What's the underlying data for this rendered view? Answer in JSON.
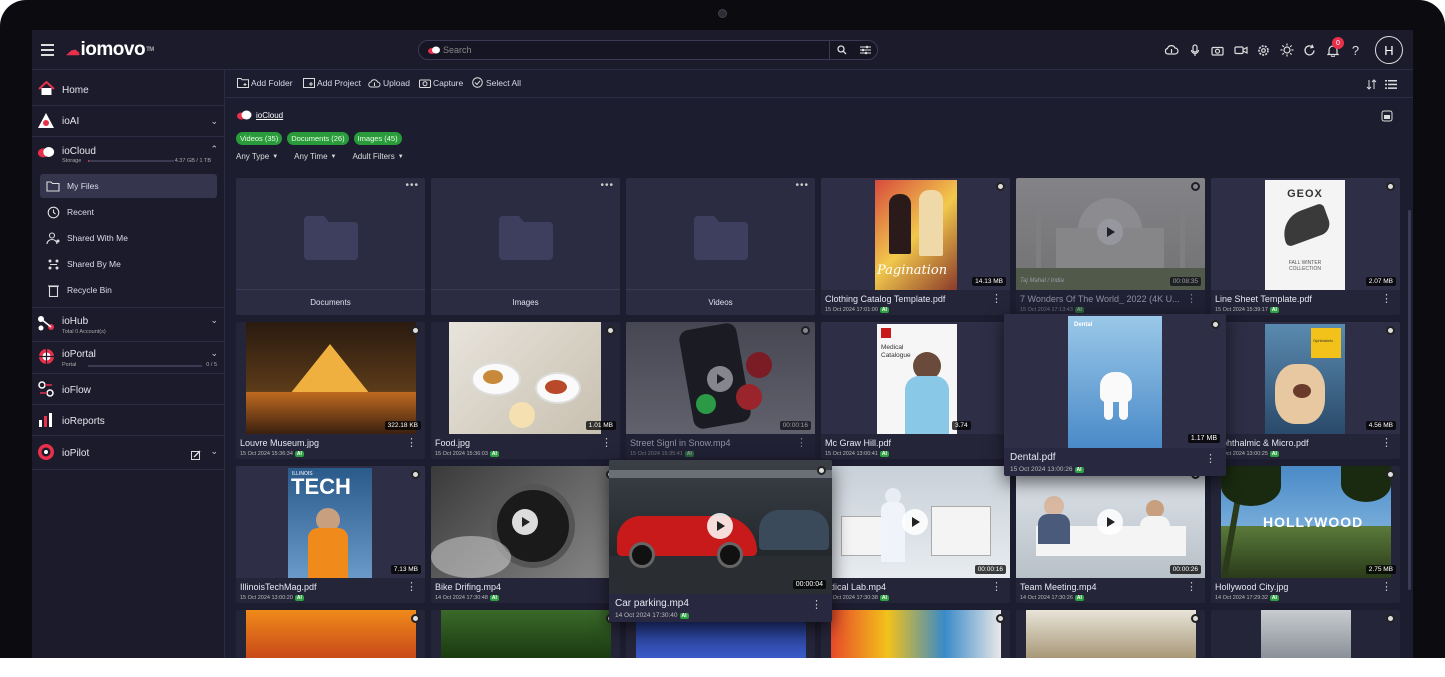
{
  "app": {
    "logo": "iomovo",
    "tm": "TM"
  },
  "search": {
    "placeholder": "Search"
  },
  "user": {
    "initial": "H",
    "notifications": "0"
  },
  "sidebar": {
    "home": "Home",
    "ioai": "ioAI",
    "iocloud": {
      "label": "ioCloud",
      "storage_label": "Storage",
      "storage_value": "4.37 GB / 1 TB",
      "storage_fraction": 0.004
    },
    "subitems": [
      "My Files",
      "Recent",
      "Shared With Me",
      "Shared By Me",
      "Recycle Bin"
    ],
    "iohub": {
      "label": "ioHub",
      "sub": "Total 0 Account(s)"
    },
    "ioportal": {
      "label": "ioPortal",
      "sub": "Portal",
      "value": "0 / 5"
    },
    "ioflow": "ioFlow",
    "ioreports": "ioReports",
    "iopilot": "ioPilot"
  },
  "toolbar": {
    "add_folder": "Add Folder",
    "add_project": "Add Project",
    "upload": "Upload",
    "capture": "Capture",
    "select_all": "Select All"
  },
  "breadcrumb": "ioCloud",
  "chips": [
    "Videos (35)",
    "Documents (26)",
    "Images (45)"
  ],
  "filters": [
    "Any Type",
    "Any Time",
    "Adult Filters"
  ],
  "folders": [
    "Documents",
    "Images",
    "Videos"
  ],
  "files": [
    {
      "name": "Clothing Catalog Template.pdf",
      "date": "15 Oct 2024 17:01:00",
      "size": "14.13 MB"
    },
    {
      "name": "7 Wonders Of The World_ 2022 (4K U...",
      "date": "15 Oct 2024 17:13:43",
      "size": "00:08:35"
    },
    {
      "name": "Line Sheet Template.pdf",
      "date": "15 Oct 2024 15:39:17",
      "size": "2.07 MB"
    },
    {
      "name": "Louvre Museum.jpg",
      "date": "15 Oct 2024 15:36:34",
      "size": "322.18 KB"
    },
    {
      "name": "Food.jpg",
      "date": "15 Oct 2024 15:36:03",
      "size": "1.01 MB"
    },
    {
      "name": "Street Signl in Snow.mp4",
      "date": "15 Oct 2024 15:35:41",
      "size": "00:00:16"
    },
    {
      "name": "Mc Graw Hill.pdf",
      "date": "15 Oct 2024 13:00:41",
      "size": "3.74"
    },
    {
      "name": "Dental.pdf",
      "date": "15 Oct 2024 13:00:26",
      "size": "1.17 MB"
    },
    {
      "name": "Ophthalmic & Micro.pdf",
      "date": "15 Oct 2024 13:00:25",
      "size": "4.56 MB"
    },
    {
      "name": "IllinoisTechMag.pdf",
      "date": "15 Oct 2024 13:00:20",
      "size": "7.13 MB"
    },
    {
      "name": "Bike Drifing.mp4",
      "date": "14 Oct 2024 17:30:48",
      "size": ""
    },
    {
      "name": "Car parking.mp4",
      "date": "14 Oct 2024 17:30:40",
      "size": "00:00:04"
    },
    {
      "name": "edical Lab.mp4",
      "date": "14 Oct 2024 17:30:38",
      "size": "00:00:16"
    },
    {
      "name": "Team Meeting.mp4",
      "date": "14 Oct 2024 17:30:26",
      "size": "00:00:26"
    },
    {
      "name": "Hollywood City.jpg",
      "date": "14 Oct 2024 17:29:32",
      "size": "2.75 MB"
    }
  ],
  "thumb_text": {
    "pagination": "Pagination",
    "taj": "Taj Mahal / India",
    "geox": "GEOX",
    "geox_sub": "FALL WINTER COLLECTION",
    "mcgraw": "Medical Catalogue",
    "dental": "Dental",
    "tech": "TECH",
    "tech_top": "ILLINOIS",
    "hollywood": "HOLLYWOOD",
    "ophth": "Ophthalmic"
  },
  "ai_badge": "AI",
  "colors": {
    "bg": "#1d1d30",
    "panel": "#1b1b2c",
    "card": "#25253a",
    "accent": "#e8304b",
    "chip": "#2a9b3a"
  }
}
